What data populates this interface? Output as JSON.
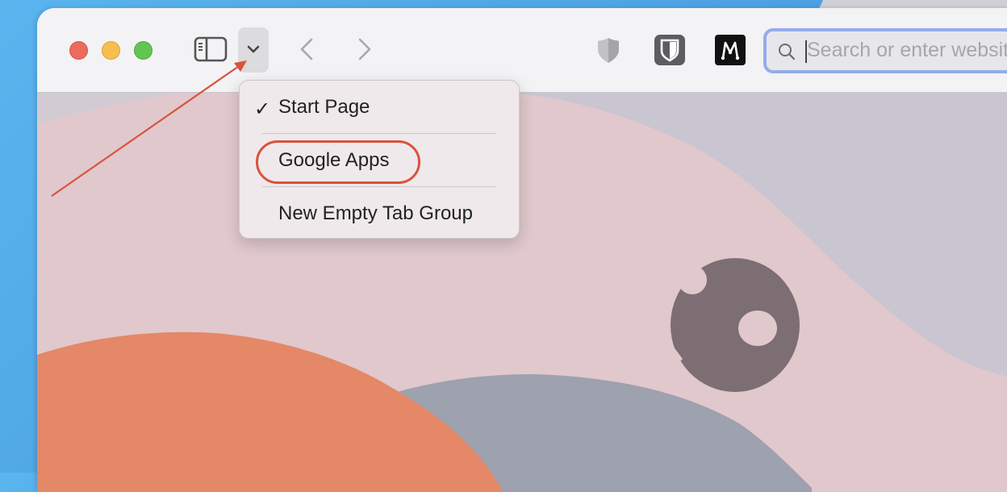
{
  "window": {
    "traffic_lights": [
      "close",
      "minimize",
      "maximize"
    ],
    "colors": {
      "close": "#ec6a5e",
      "minimize": "#f4bf4f",
      "maximize": "#61c554"
    }
  },
  "toolbar": {
    "sidebar_icon": "sidebar-icon",
    "tab_group_icon": "chevron-down-icon",
    "back_icon": "chevron-left-icon",
    "forward_icon": "chevron-right-icon",
    "extensions": [
      {
        "name": "privacy-shield-extension",
        "icon": "shield-icon"
      },
      {
        "name": "bitwarden-extension",
        "icon": "bitwarden-shield-icon"
      },
      {
        "name": "m-extension",
        "icon": "m-letter-icon",
        "label": "M"
      }
    ],
    "search": {
      "placeholder": "Search or enter website name",
      "value": ""
    }
  },
  "tab_group_menu": {
    "items": [
      {
        "label": "Start Page",
        "checked": true
      },
      {
        "label": "Google Apps",
        "checked": false,
        "annotated": true
      },
      {
        "label": "New Empty Tab Group",
        "checked": false
      }
    ],
    "checkmark": "✓"
  },
  "annotation": {
    "color": "#d9533d",
    "target": "tab-group-button"
  },
  "colors": {
    "accent_focus": "#95acea",
    "wallpaper_pink": "#e0c8cd",
    "wallpaper_orange": "#e48867"
  }
}
